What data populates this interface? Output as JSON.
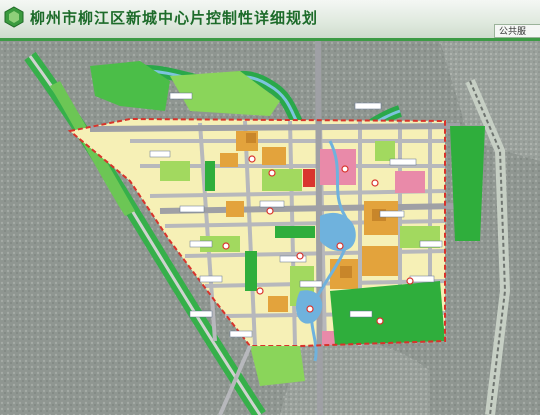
{
  "header": {
    "title": "柳州市柳江区新城中心片控制性详细规划",
    "tab_label": "公共服",
    "logo_icon": "hexagon-logo-icon"
  },
  "colors": {
    "title": "#1d6b2a",
    "header_rule": "#3d9b45",
    "terrain": "#8c948f",
    "road": "#b9b9bd",
    "green_space": "#2fae3c",
    "light_green": "#9bd65a",
    "residential": "#fbf3b4",
    "commercial": "#e2a53b",
    "public_facility": "#e98aa9",
    "admin": "#d9352e",
    "water": "#6fb2dd",
    "boundary": "#d8332b"
  },
  "map": {
    "description_icon": "land-use-map"
  }
}
